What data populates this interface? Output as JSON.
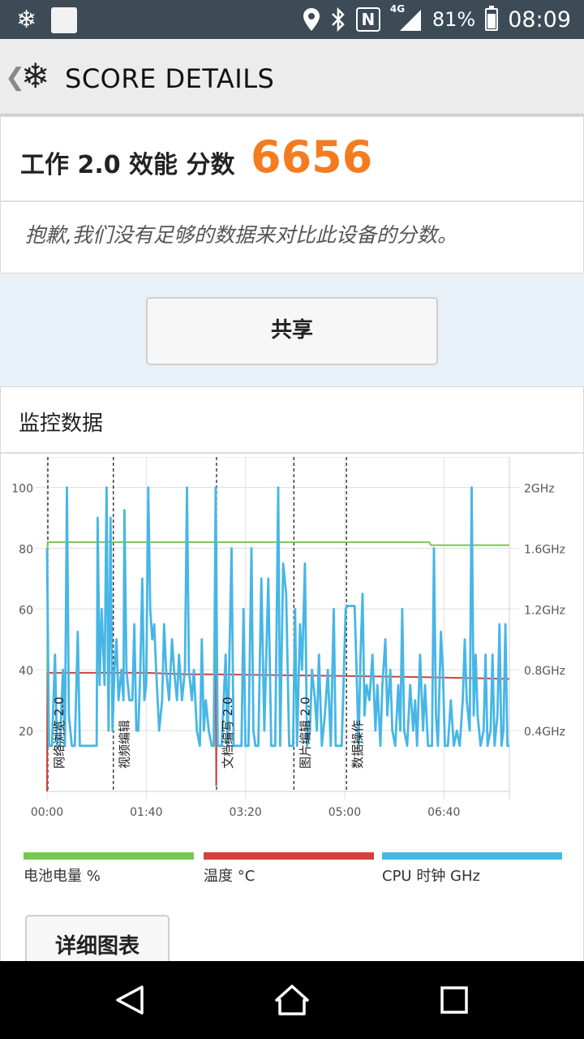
{
  "status_bar": {
    "network": "4G",
    "battery": "81%",
    "battery_level": 0.81,
    "time": "08:09"
  },
  "toolbar": {
    "back_glyph": "❮",
    "logo_glyph": "❄",
    "title": "SCORE DETAILS"
  },
  "score": {
    "label": "工作 2.0 效能 分数",
    "value": "6656",
    "note": "抱歉,我们没有足够的数据来对比此设备的分数。"
  },
  "share_button": "共享",
  "monitor": {
    "title": "监控数据",
    "chart_data": {
      "type": "line",
      "x": [
        "00:00",
        "01:40",
        "03:20",
        "05:00",
        "06:40"
      ],
      "x_ticks_seconds": [
        0,
        100,
        200,
        300,
        400
      ],
      "x_range_seconds": [
        0,
        466
      ],
      "y_left_ticks": [
        20,
        40,
        60,
        80,
        100
      ],
      "y_left_range": [
        0,
        110
      ],
      "y_right_ticks": [
        "0.4GHz",
        "0.8GHz",
        "1.2GHz",
        "1.6GHz",
        "2GHz"
      ],
      "y_right_ticks_value": [
        0.4,
        0.8,
        1.2,
        1.6,
        2.0
      ],
      "y_right_range": [
        0,
        2.2
      ],
      "grid": true,
      "sections": [
        {
          "label": "网络浏览 2.0",
          "start": 0
        },
        {
          "label": "视频编辑",
          "start": 66
        },
        {
          "label": "文档编写 2.0",
          "start": 170
        },
        {
          "label": "图片编辑 2.0",
          "start": 248
        },
        {
          "label": "数据操作",
          "start": 301
        }
      ],
      "series": [
        {
          "name": "电池电量 %",
          "axis": "left",
          "color": "#78c850",
          "points": [
            [
              0,
              0
            ],
            [
              0.5,
              82
            ],
            [
              170,
              82
            ],
            [
              170.5,
              2
            ],
            [
              171,
              82
            ],
            [
              385,
              82
            ],
            [
              387,
              81
            ],
            [
              466,
              81
            ]
          ]
        },
        {
          "name": "温度 °C",
          "axis": "left",
          "color": "#d0423f",
          "points": [
            [
              0,
              0
            ],
            [
              0.5,
              39
            ],
            [
              100,
              39
            ],
            [
              140,
              38.5
            ],
            [
              170,
              38.5
            ],
            [
              170.5,
              2
            ],
            [
              171,
              38.5
            ],
            [
              240,
              38.2
            ],
            [
              300,
              38
            ],
            [
              380,
              37.6
            ],
            [
              466,
              37
            ]
          ]
        },
        {
          "name": "CPU 时钟 GHz",
          "axis": "right",
          "color": "#47b6e6",
          "points": [
            [
              0,
              1.6
            ],
            [
              2,
              0.3
            ],
            [
              5,
              0.3
            ],
            [
              8,
              0.9
            ],
            [
              10,
              0.3
            ],
            [
              13,
              0.3
            ],
            [
              16,
              0.8
            ],
            [
              18,
              0.3
            ],
            [
              20,
              2.0
            ],
            [
              22,
              0.5
            ],
            [
              25,
              0.3
            ],
            [
              28,
              0.3
            ],
            [
              31,
              1.05
            ],
            [
              33,
              0.3
            ],
            [
              38,
              0.3
            ],
            [
              42,
              0.3
            ],
            [
              44,
              0.3
            ],
            [
              50,
              0.3
            ],
            [
              51,
              1.8
            ],
            [
              53,
              0.7
            ],
            [
              55,
              1.2
            ],
            [
              58,
              0.7
            ],
            [
              60,
              2.0
            ],
            [
              62,
              0.4
            ],
            [
              64,
              1.8
            ],
            [
              66,
              0.4
            ],
            [
              68,
              0.8
            ],
            [
              70,
              1.0
            ],
            [
              72,
              0.6
            ],
            [
              75,
              0.8
            ],
            [
              77,
              0.6
            ],
            [
              78,
              1.85
            ],
            [
              80,
              0.8
            ],
            [
              83,
              0.6
            ],
            [
              86,
              0.6
            ],
            [
              88,
              1.1
            ],
            [
              90,
              0.4
            ],
            [
              92,
              0.4
            ],
            [
              94,
              0.8
            ],
            [
              96,
              1.4
            ],
            [
              98,
              0.6
            ],
            [
              100,
              0.7
            ],
            [
              102,
              2.0
            ],
            [
              104,
              1.2
            ],
            [
              106,
              1.0
            ],
            [
              108,
              1.1
            ],
            [
              110,
              0.8
            ],
            [
              113,
              0.4
            ],
            [
              116,
              0.6
            ],
            [
              118,
              1.1
            ],
            [
              120,
              0.8
            ],
            [
              123,
              0.6
            ],
            [
              126,
              1.0
            ],
            [
              128,
              0.8
            ],
            [
              131,
              0.6
            ],
            [
              133,
              0.9
            ],
            [
              136,
              0.6
            ],
            [
              139,
              0.8
            ],
            [
              141,
              2.0
            ],
            [
              143,
              0.8
            ],
            [
              146,
              0.6
            ],
            [
              148,
              0.8
            ],
            [
              151,
              0.4
            ],
            [
              154,
              0.3
            ],
            [
              156,
              1.0
            ],
            [
              158,
              0.4
            ],
            [
              160,
              0.6
            ],
            [
              163,
              0.4
            ],
            [
              166,
              0.3
            ],
            [
              168,
              0.3
            ],
            [
              170,
              2.0
            ],
            [
              172,
              0.3
            ],
            [
              176,
              0.3
            ],
            [
              180,
              0.9
            ],
            [
              182,
              0.3
            ],
            [
              186,
              1.6
            ],
            [
              188,
              0.3
            ],
            [
              192,
              0.3
            ],
            [
              196,
              0.3
            ],
            [
              198,
              1.2
            ],
            [
              200,
              0.3
            ],
            [
              203,
              0.3
            ],
            [
              206,
              1.6
            ],
            [
              208,
              0.4
            ],
            [
              210,
              0.3
            ],
            [
              213,
              0.3
            ],
            [
              216,
              1.4
            ],
            [
              219,
              0.4
            ],
            [
              223,
              1.4
            ],
            [
              226,
              0.3
            ],
            [
              230,
              0.3
            ],
            [
              233,
              2.0
            ],
            [
              235,
              0.3
            ],
            [
              238,
              1.5
            ],
            [
              241,
              1.3
            ],
            [
              244,
              0.3
            ],
            [
              248,
              0.3
            ],
            [
              250,
              1.2
            ],
            [
              252,
              0.3
            ],
            [
              255,
              1.1
            ],
            [
              257,
              0.8
            ],
            [
              260,
              1.5
            ],
            [
              262,
              0.3
            ],
            [
              265,
              0.4
            ],
            [
              267,
              0.8
            ],
            [
              270,
              0.6
            ],
            [
              272,
              0.4
            ],
            [
              274,
              0.9
            ],
            [
              277,
              0.3
            ],
            [
              280,
              0.5
            ],
            [
              283,
              0.8
            ],
            [
              286,
              0.3
            ],
            [
              289,
              1.2
            ],
            [
              291,
              0.3
            ],
            [
              294,
              0.3
            ],
            [
              297,
              0.3
            ],
            [
              301,
              1.2
            ],
            [
              303,
              1.22
            ],
            [
              310,
              1.22
            ],
            [
              312,
              0.8
            ],
            [
              314,
              0.3
            ],
            [
              316,
              0.9
            ],
            [
              318,
              1.3
            ],
            [
              320,
              0.5
            ],
            [
              322,
              0.7
            ],
            [
              325,
              0.6
            ],
            [
              328,
              0.9
            ],
            [
              331,
              0.4
            ],
            [
              333,
              0.7
            ],
            [
              336,
              0.3
            ],
            [
              338,
              0.7
            ],
            [
              341,
              1.0
            ],
            [
              343,
              0.5
            ],
            [
              346,
              0.8
            ],
            [
              348,
              0.4
            ],
            [
              351,
              0.3
            ],
            [
              354,
              0.7
            ],
            [
              356,
              0.4
            ],
            [
              358,
              1.2
            ],
            [
              360,
              0.4
            ],
            [
              363,
              0.3
            ],
            [
              366,
              0.7
            ],
            [
              369,
              0.4
            ],
            [
              371,
              0.6
            ],
            [
              373,
              0.3
            ],
            [
              376,
              0.9
            ],
            [
              379,
              0.4
            ],
            [
              381,
              0.7
            ],
            [
              384,
              0.3
            ],
            [
              388,
              0.3
            ],
            [
              390,
              1.6
            ],
            [
              392,
              0.5
            ],
            [
              394,
              0.3
            ],
            [
              397,
              1.05
            ],
            [
              399,
              0.8
            ],
            [
              401,
              0.3
            ],
            [
              404,
              0.3
            ],
            [
              407,
              0.6
            ],
            [
              410,
              0.3
            ],
            [
              413,
              0.4
            ],
            [
              416,
              0.3
            ],
            [
              419,
              0.6
            ],
            [
              421,
              1.0
            ],
            [
              423,
              0.6
            ],
            [
              426,
              0.4
            ],
            [
              428,
              2.0
            ],
            [
              430,
              0.5
            ],
            [
              432,
              0.9
            ],
            [
              434,
              0.5
            ],
            [
              437,
              0.3
            ],
            [
              440,
              0.4
            ],
            [
              442,
              0.9
            ],
            [
              444,
              0.3
            ],
            [
              447,
              0.4
            ],
            [
              449,
              0.9
            ],
            [
              451,
              0.3
            ],
            [
              454,
              0.5
            ],
            [
              456,
              1.1
            ],
            [
              458,
              0.3
            ],
            [
              460,
              0.4
            ],
            [
              462,
              1.1
            ],
            [
              464,
              0.3
            ],
            [
              466,
              0.3
            ]
          ]
        }
      ]
    },
    "legend": [
      {
        "label": "电池电量 %",
        "color": "#78c850"
      },
      {
        "label": "温度 °C",
        "color": "#d0423f"
      },
      {
        "label": "CPU 时钟 GHz",
        "color": "#47b6e6"
      }
    ],
    "detail_button": "详细图表"
  },
  "nav": {
    "back": "back-icon",
    "home": "home-icon",
    "recents": "recents-icon"
  }
}
